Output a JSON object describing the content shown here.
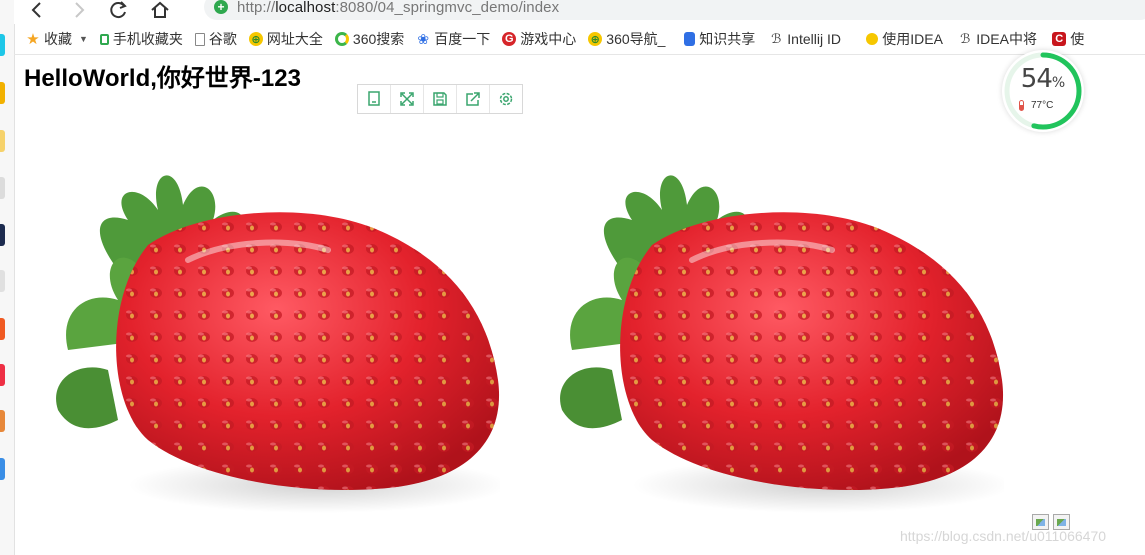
{
  "browser": {
    "url_prefix": "http://",
    "url_host": "localhost",
    "url_path": ":8080/04_springmvc_demo/index"
  },
  "bookmarks": [
    {
      "label": "收藏",
      "icon": "star-icon",
      "dropdown": true
    },
    {
      "label": "手机收藏夹",
      "icon": "phone-icon"
    },
    {
      "label": "谷歌",
      "icon": "page-icon"
    },
    {
      "label": "网址大全",
      "icon": "360-nav-icon"
    },
    {
      "label": "360搜索",
      "icon": "360-search-icon"
    },
    {
      "label": "百度一下",
      "icon": "baidu-paw-icon"
    },
    {
      "label": "游戏中心",
      "icon": "game-center-icon"
    },
    {
      "label": "360导航_",
      "icon": "360-nav-icon"
    },
    {
      "label": "知识共享",
      "icon": "book-icon"
    },
    {
      "label": "Intellij ID",
      "icon": "idea-icon"
    },
    {
      "label": "使用IDEA",
      "icon": "sun-icon"
    },
    {
      "label": "IDEA中将",
      "icon": "idea-icon"
    },
    {
      "label": "使",
      "icon": "csdn-icon"
    }
  ],
  "page": {
    "heading": "HelloWorld,你好世界-123"
  },
  "image_toolbar": [
    "copy-icon",
    "fullscreen-icon",
    "save-icon",
    "share-icon",
    "settings-icon"
  ],
  "cpu_widget": {
    "percent": "54",
    "percent_sign": "%",
    "usage_fraction": 0.54,
    "temperature": "77°C"
  },
  "images": [
    "strawberry-image",
    "strawberry-image"
  ],
  "watermark": "https://blog.csdn.net/u011066470",
  "colors": {
    "gauge_green": "#21c45c",
    "toolbar_icon": "#3aa56e",
    "berry_red": "#e3222c",
    "leaf_green": "#4f9a3a"
  }
}
